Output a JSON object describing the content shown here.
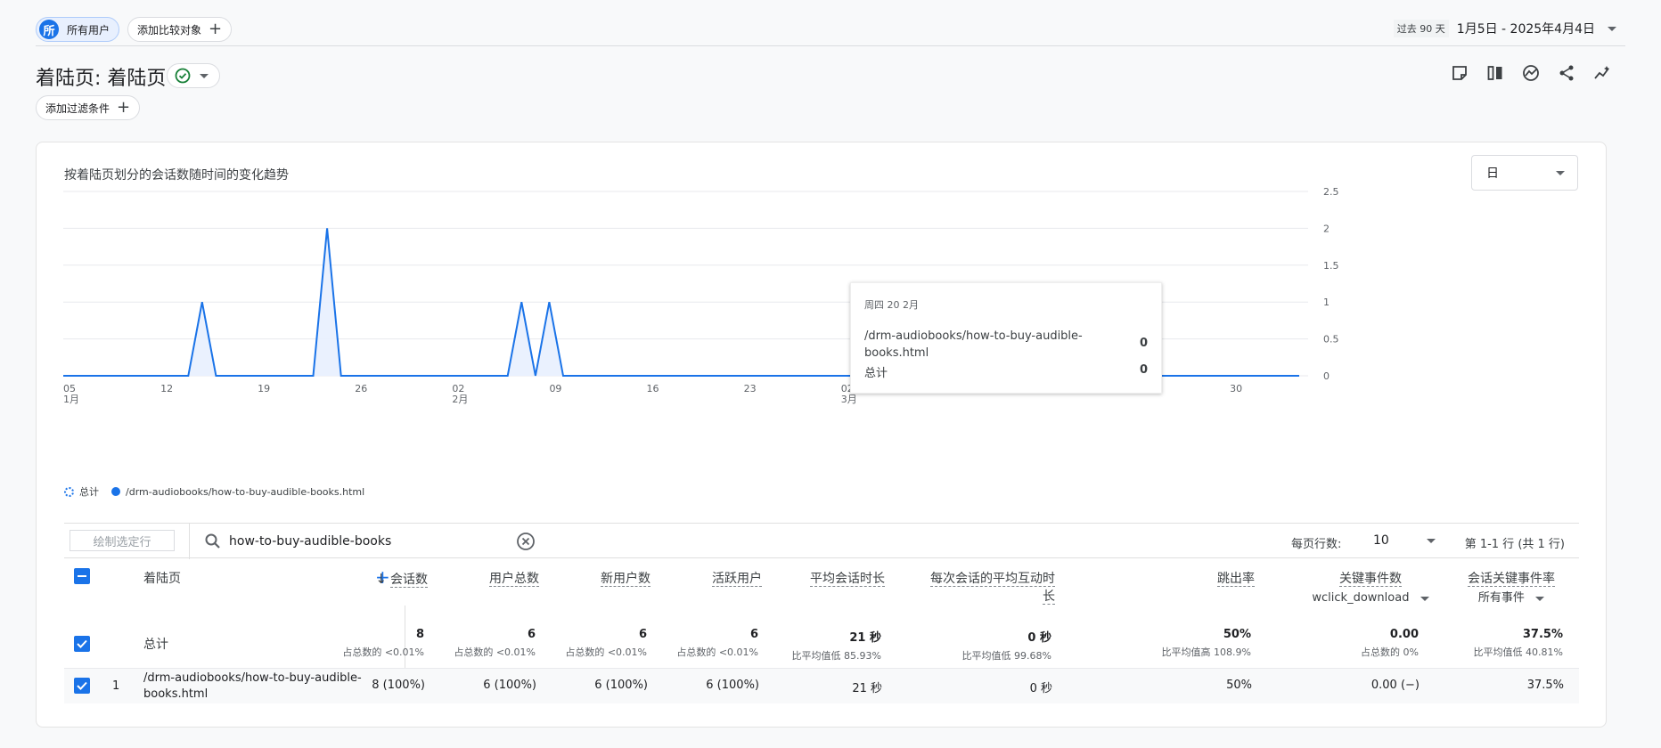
{
  "topbar": {
    "segment_avatar": "所",
    "segment_label": "所有用户",
    "compare_label": "添加比较对象",
    "date_tag": "过去 90 天",
    "date_range": "1月5日 - 2025年4月4日"
  },
  "title": "着陆页: 着陆页",
  "filter_label": "添加过滤条件",
  "toolbar_icons": [
    "note-icon",
    "compare-columns-icon",
    "insights-icon",
    "share-icon",
    "trend-icon"
  ],
  "card": {
    "title": "按着陆页划分的会话数随时间的变化趋势",
    "granularity": "日"
  },
  "tooltip": {
    "date": "周四 20 2月",
    "series_label": "/drm-audiobooks/how-to-buy-audible-books.html",
    "series_value": "0",
    "total_label": "总计",
    "total_value": "0"
  },
  "legend": {
    "total": "总计",
    "series": "/drm-audiobooks/how-to-buy-audible-books.html"
  },
  "chart_data": {
    "type": "area",
    "y_ticks": [
      "2.5",
      "2",
      "1.5",
      "1",
      "0.5",
      "0"
    ],
    "ylim": [
      0,
      2.5
    ],
    "x_ticks": [
      {
        "day": "05",
        "month": "1月"
      },
      {
        "day": "12",
        "month": ""
      },
      {
        "day": "19",
        "month": ""
      },
      {
        "day": "26",
        "month": ""
      },
      {
        "day": "02",
        "month": "2月"
      },
      {
        "day": "09",
        "month": ""
      },
      {
        "day": "16",
        "month": ""
      },
      {
        "day": "23",
        "month": ""
      },
      {
        "day": "02",
        "month": "3月"
      },
      {
        "day": "09",
        "month": ""
      },
      {
        "day": "16",
        "month": ""
      },
      {
        "day": "23",
        "month": ""
      },
      {
        "day": "30",
        "month": ""
      }
    ],
    "x_start": "2025-01-05",
    "series": [
      {
        "name": "/drm-audiobooks/how-to-buy-audible-books.html",
        "color": "#1a73e8",
        "values": [
          0,
          0,
          0,
          0,
          0,
          0,
          0,
          0,
          0,
          0,
          1,
          0,
          0,
          0,
          0,
          0,
          0,
          0,
          0,
          2,
          0,
          0,
          0,
          0,
          0,
          0,
          0,
          0,
          0,
          0,
          0,
          0,
          0,
          1,
          0,
          1,
          0,
          0,
          0,
          0,
          0,
          0,
          0,
          0,
          0,
          0,
          0,
          0,
          0,
          0,
          0,
          0,
          0,
          0,
          0,
          0,
          0,
          0,
          0,
          0,
          0,
          0,
          0,
          0,
          0,
          0,
          0,
          0,
          0,
          0,
          0,
          0,
          0,
          0,
          0,
          1,
          1,
          0,
          0,
          0,
          0,
          0,
          0,
          0,
          0,
          0,
          0,
          0,
          0,
          0
        ]
      }
    ]
  },
  "table": {
    "plot_rows": "绘制选定行",
    "search_value": "how-to-buy-audible-books",
    "rows_per_page_label": "每页行数:",
    "rows_per_page": "10",
    "pager": "第 1-1 行 (共 1 行)",
    "dimension_header": "着陆页",
    "headers": {
      "sessions": "会话数",
      "total_users": "用户总数",
      "new_users": "新用户数",
      "active_users": "活跃用户",
      "avg_session": "平均会话时长",
      "avg_engagement_1": "每次会话的平均互动时",
      "avg_engagement_2": "长",
      "bounce": "跳出率",
      "key_events": "关键事件数",
      "key_events_sub": "wclick_download",
      "key_rate": "会话关键事件率",
      "key_rate_sub": "所有事件"
    },
    "total": {
      "label": "总计",
      "sessions": "8",
      "sessions_sub": "占总数的 <0.01%",
      "total_users": "6",
      "total_users_sub": "占总数的 <0.01%",
      "new_users": "6",
      "new_users_sub": "占总数的 <0.01%",
      "active_users": "6",
      "active_users_sub": "占总数的 <0.01%",
      "avg_session": "21 秒",
      "avg_session_sub": "比平均值低 85.93%",
      "avg_engagement": "0 秒",
      "avg_engagement_sub": "比平均值低 99.68%",
      "bounce": "50%",
      "bounce_sub": "比平均值高 108.9%",
      "key_events": "0.00",
      "key_events_sub": "占总数的 0%",
      "key_rate": "37.5%",
      "key_rate_sub": "比平均值低 40.81%"
    },
    "rows": [
      {
        "index": "1",
        "page_1": "/drm-audiobooks/how-to-buy-audible-",
        "page_2": "books.html",
        "sessions": "8 (100%)",
        "total_users": "6 (100%)",
        "new_users": "6 (100%)",
        "active_users": "6 (100%)",
        "avg_session": "21 秒",
        "avg_engagement": "0 秒",
        "bounce": "50%",
        "key_events": "0.00 (−)",
        "key_rate": "37.5%"
      }
    ]
  }
}
